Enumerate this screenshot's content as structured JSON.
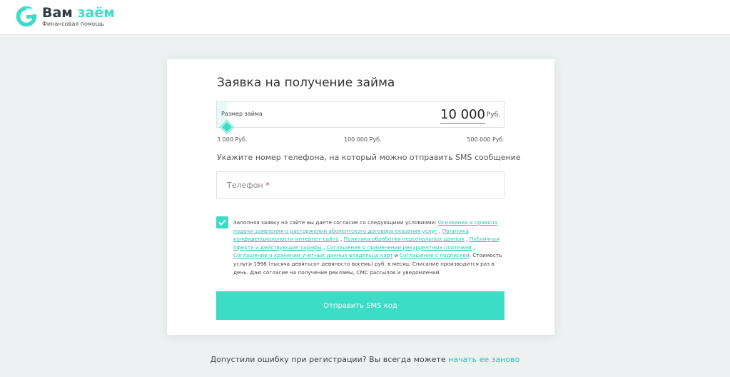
{
  "header": {
    "logo_title": "Вам",
    "logo_title_accent": "заём",
    "logo_subtitle": "Финансовая помощь"
  },
  "form": {
    "title": "Заявка на получение займа",
    "amount_label": "Размер займа",
    "amount_value": "10 000",
    "amount_unit": "Руб.",
    "slider_min_label": "3 000 Руб.",
    "slider_mid_label": "100 000 Руб.",
    "slider_max_label": "500 000 Руб.",
    "slider_value": 10000,
    "phone_hint": "Укажите номер телефона, на который можно отправить SMS сообщение",
    "phone_placeholder": "Телефон",
    "phone_required_mark": "*",
    "phone_value": "",
    "consent_checked": true,
    "consent_intro": "Заполняя заявку на сайте вы даете согласие со следующими условиями:",
    "consent_links": [
      "Основания и правила подачи заявления о расторжении абонентского договора оказания услуг",
      "Политика конфиденциальности интернет-сайта",
      "Политика обработки персональных данных",
      "Публичная оферта и действующие тарифы",
      "Соглашение о применении рекуррентных платежей",
      "Соглашение о хранении учетных данных владельца карт",
      "Соглашение с подпиской"
    ],
    "consent_sep_comma": ",",
    "consent_and": "и",
    "consent_outro": ". Стоимость услуги 1998 (тысяча девятьсот девяносто восемь) руб. в месяц. Списание производится раз в день. Даю согласие на получение рекламы, СМС рассылок и уведомлений.",
    "submit_label": "Отправить SMS код"
  },
  "footer": {
    "text": "Допустили ошибку при регистрации? Вы всегда можете",
    "link_text": "начать ее заново"
  },
  "colors": {
    "accent": "#3ddcc7",
    "link": "#2bc4b0",
    "background": "#eef1f2",
    "required": "#e53935"
  }
}
